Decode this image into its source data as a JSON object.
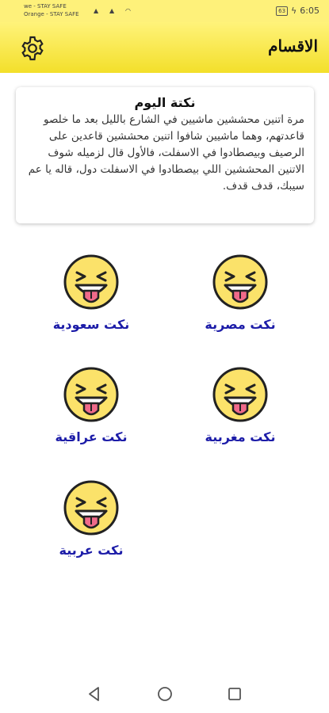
{
  "status_bar": {
    "carrier1": "we - STAY SAFE",
    "carrier2": "Orange - STAY SAFE",
    "battery": "63",
    "time": "6:05"
  },
  "app_bar": {
    "title": "الاقسام",
    "settings_icon": "gear-icon",
    "color": "#f3df2a"
  },
  "joke_of_day": {
    "title": "نكتة اليوم",
    "text": "مرة اتنين محششين ماشيين في الشارع بالليل بعد ما خلصو قاعدتهم، وهما ماشيين شافوا اتنين محششين قاعدين على الرصيف وبيصطادوا في الاسفلت، فالأول قال لزميله شوف الاتنين المحششين اللي بيصطادوا في الاسفلت دول، قاله يا عم سيبك، قدف قدف."
  },
  "categories": [
    {
      "label": "نكت مصرية",
      "icon": "laughing-face-icon"
    },
    {
      "label": "نكت سعودية",
      "icon": "laughing-face-icon"
    },
    {
      "label": "نكت مغربية",
      "icon": "laughing-face-icon"
    },
    {
      "label": "نكت عراقية",
      "icon": "laughing-face-icon"
    },
    {
      "label": "نكت عربية",
      "icon": "laughing-face-icon"
    }
  ],
  "colors": {
    "accent": "#f3df2a",
    "category_label": "#1c1ca8",
    "face": "#fbe26a"
  }
}
